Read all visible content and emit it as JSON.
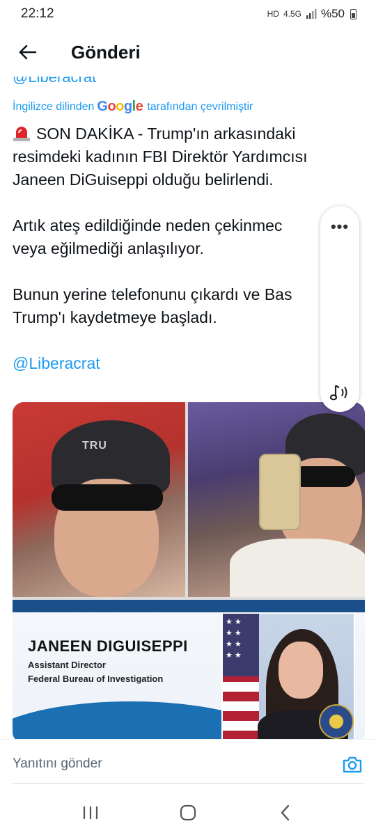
{
  "status_bar": {
    "time": "22:12",
    "network": "4.5G",
    "battery": "%50",
    "hd_label": "HD"
  },
  "header": {
    "title": "Gönderi"
  },
  "post": {
    "cut_handle": "@Liberacrat",
    "translation": {
      "prefix": "İngilizce dilinden",
      "provider": "Google",
      "suffix": "tarafından çevrilmiştir"
    },
    "paragraphs": [
      "SON DAKİKA - Trump'ın arkasındaki",
      "resimdeki kadının FBI Direktör Yardımcısı",
      "Janeen DiGuiseppi olduğu belirlendi.",
      "Artık ateş edildiğinde neden çekinmec",
      "veya eğilmediği anlaşılıyor.",
      "Bunun yerine telefonunu çıkardı ve Bas",
      "Trump'ı kaydetmeye başladı."
    ],
    "mention": "@Liberacrat",
    "media": {
      "cap_text_left": "TRU",
      "banner_name": "JANEEN DIGUISEPPI",
      "banner_role": "Assistant Director",
      "banner_org": "Federal Bureau of Investigation"
    }
  },
  "floating_actions": {
    "more": "•••"
  },
  "reply": {
    "placeholder": "Yanıtını gönder"
  },
  "colors": {
    "link": "#1d9bf0",
    "text": "#0f1419",
    "muted": "#536471"
  }
}
